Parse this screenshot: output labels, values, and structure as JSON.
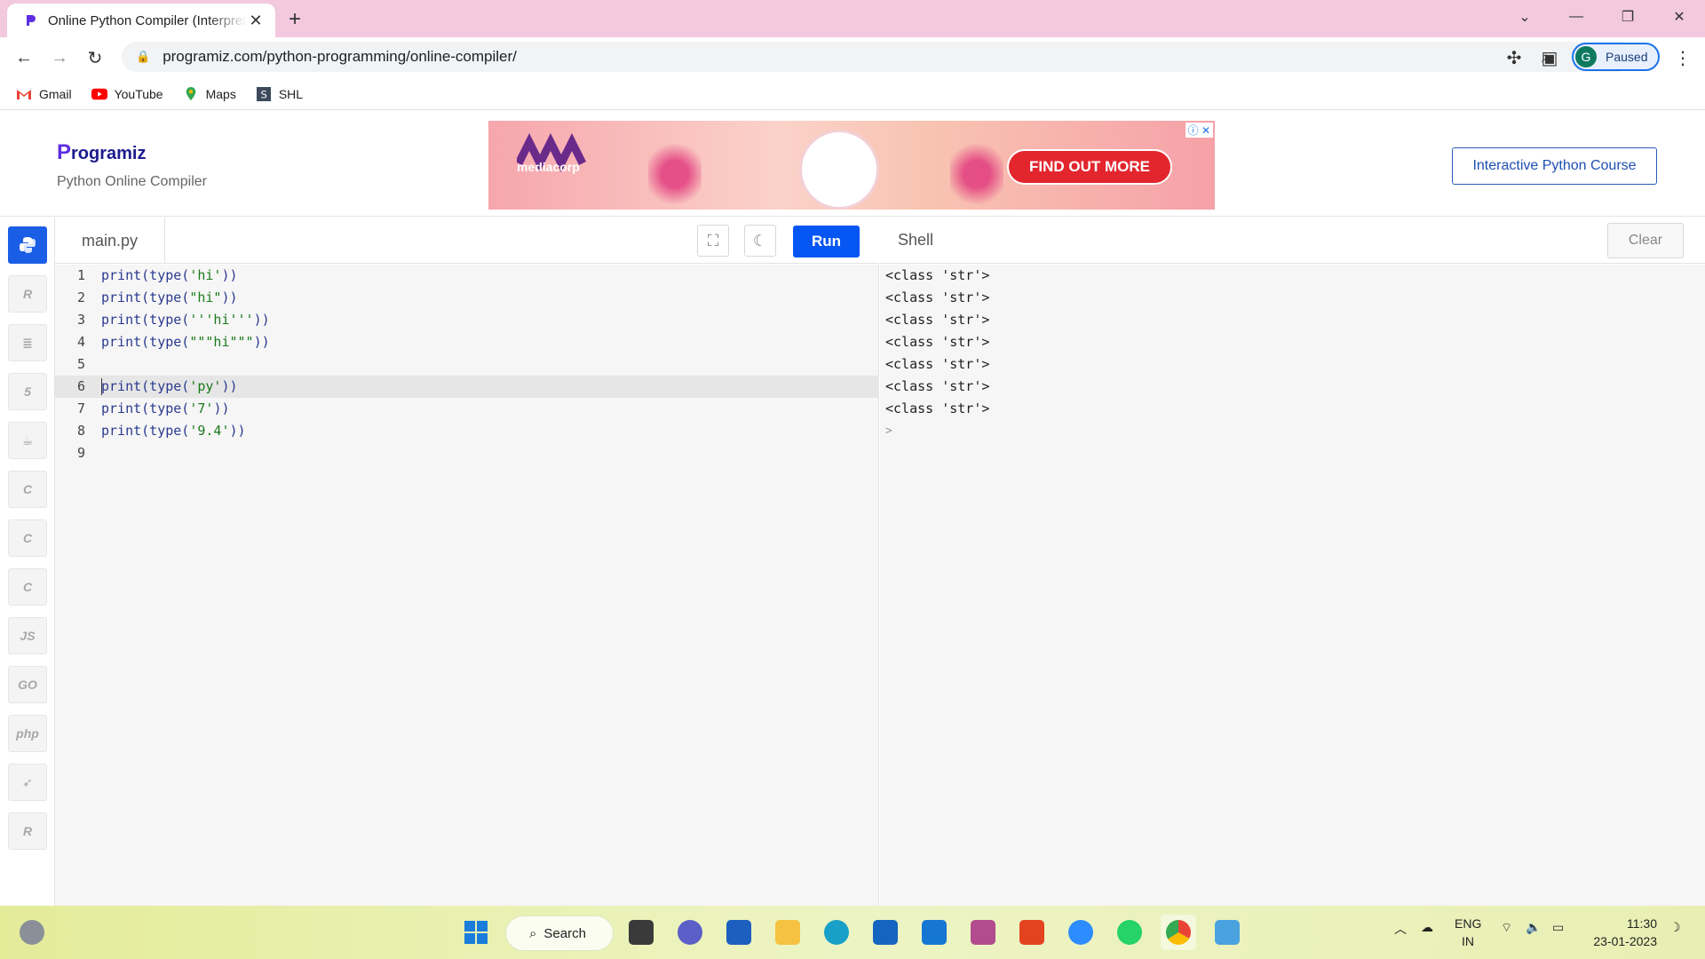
{
  "browser": {
    "tab_title": "Online Python Compiler (Interpreter)",
    "url": "programiz.com/python-programming/online-compiler/",
    "profile_initial": "G",
    "profile_status": "Paused",
    "bookmarks": [
      {
        "label": "Gmail",
        "icon": "gmail-icon"
      },
      {
        "label": "YouTube",
        "icon": "youtube-icon"
      },
      {
        "label": "Maps",
        "icon": "maps-icon"
      },
      {
        "label": "SHL",
        "icon": "shl-icon"
      }
    ]
  },
  "site": {
    "logo": "rogramiz",
    "logo_initial": "P",
    "subtitle": "Python Online Compiler",
    "course_button": "Interactive Python Course",
    "ad": {
      "brand": "mediacorp",
      "cta": "FIND OUT MORE"
    }
  },
  "languages": [
    {
      "name": "python-icon",
      "label": ""
    },
    {
      "name": "r-icon",
      "label": "R"
    },
    {
      "name": "sql-icon",
      "label": "≣"
    },
    {
      "name": "html-icon",
      "label": "5"
    },
    {
      "name": "java-icon",
      "label": "☕"
    },
    {
      "name": "c-icon",
      "label": "C"
    },
    {
      "name": "cpp-icon",
      "label": "C"
    },
    {
      "name": "csharp-icon",
      "label": "C"
    },
    {
      "name": "js-icon",
      "label": "JS"
    },
    {
      "name": "go-icon",
      "label": "GO"
    },
    {
      "name": "php-icon",
      "label": "php"
    },
    {
      "name": "swift-icon",
      "label": "➶"
    },
    {
      "name": "rust-icon",
      "label": "R"
    }
  ],
  "editor": {
    "file_name": "main.py",
    "run_label": "Run",
    "lines": [
      {
        "n": "1",
        "pre": "print(type(",
        "str": "'hi'",
        "post": "))"
      },
      {
        "n": "2",
        "pre": "print(type(",
        "str": "\"hi\"",
        "post": "))"
      },
      {
        "n": "3",
        "pre": "print(type(",
        "str": "'''hi'''",
        "post": "))"
      },
      {
        "n": "4",
        "pre": "print(type(",
        "str": "\"\"\"hi\"\"\"",
        "post": "))"
      },
      {
        "n": "5",
        "pre": "",
        "str": "",
        "post": ""
      },
      {
        "n": "6",
        "pre": "print(type(",
        "str": "'py'",
        "post": "))"
      },
      {
        "n": "7",
        "pre": "print(type(",
        "str": "'7'",
        "post": "))"
      },
      {
        "n": "8",
        "pre": "print(type(",
        "str": "'9.4'",
        "post": "))"
      },
      {
        "n": "9",
        "pre": "",
        "str": "",
        "post": ""
      }
    ]
  },
  "shell": {
    "title": "Shell",
    "clear_label": "Clear",
    "output": [
      "<class 'str'>",
      "<class 'str'>",
      "<class 'str'>",
      "<class 'str'>",
      "<class 'str'>",
      "<class 'str'>",
      "<class 'str'>"
    ],
    "prompt": ">"
  },
  "taskbar": {
    "search_label": "Search",
    "lang_top": "ENG",
    "lang_bottom": "IN",
    "time": "11:30",
    "date": "23-01-2023"
  },
  "colors": {
    "accent": "#0556f3",
    "tabstrip": "#f2c9de",
    "taskbar": "#e8efb4"
  }
}
